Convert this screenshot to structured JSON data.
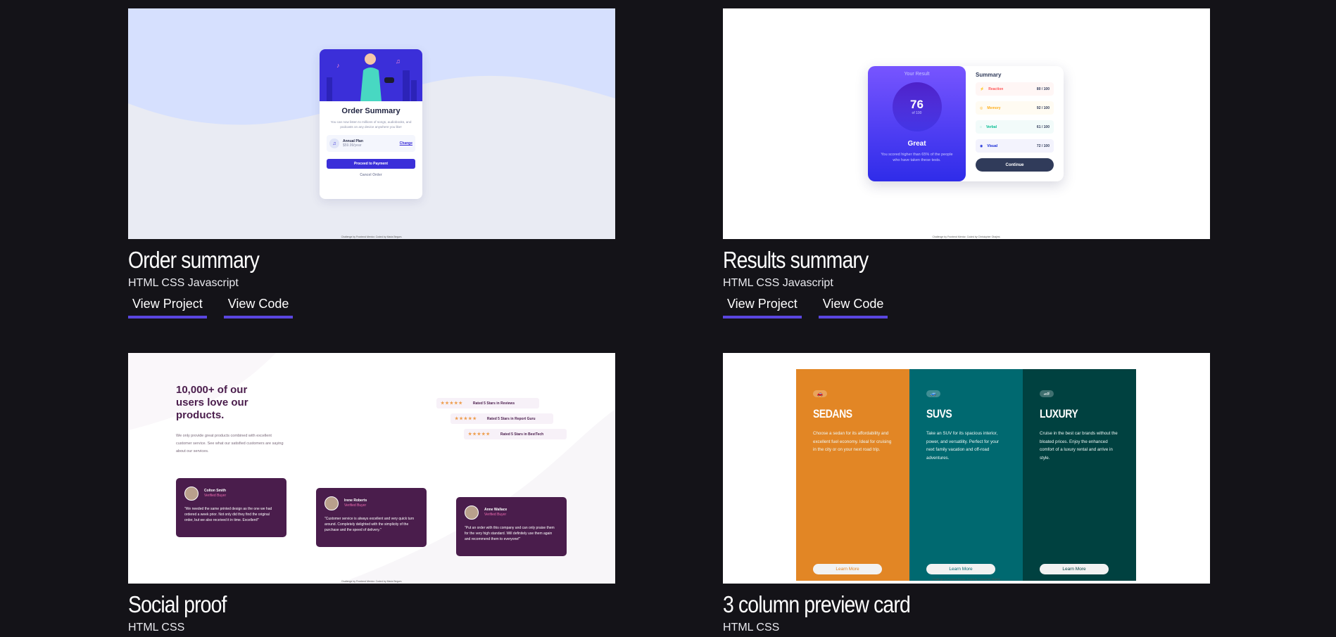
{
  "colors": {
    "background": "#141318",
    "accent_underline": "#5a46e0"
  },
  "projects": [
    {
      "title": "Order summary",
      "tech": "HTML CSS Javascript",
      "view_project": "View Project",
      "view_code": "View Code",
      "preview": {
        "card_title": "Order Summary",
        "card_text": "You can now listen to millions of songs, audiobooks, and podcasts on any device anywhere you like!",
        "plan_name": "Annual Plan",
        "plan_price": "$59.99/year",
        "change_link": "Change",
        "proceed_button": "Proceed to Payment",
        "cancel_button": "Cancel Order",
        "footer": "Challenge by Frontend Mentor. Coded by Maria Begum."
      }
    },
    {
      "title": "Results summary",
      "tech": "HTML CSS Javascript",
      "view_project": "View Project",
      "view_code": "View Code",
      "preview": {
        "your_result": "Your Result",
        "score": "76",
        "of_total": "of 100",
        "grade": "Great",
        "grade_text": "You scored higher than 65% of the people who have taken these tests.",
        "summary": "Summary",
        "rows": [
          {
            "label": "Reaction",
            "score": "80 / 100",
            "color": "#ff5757",
            "bg": "#fff6f5"
          },
          {
            "label": "Memory",
            "score": "92 / 100",
            "color": "#ffb01f",
            "bg": "#fffbf2"
          },
          {
            "label": "Verbal",
            "score": "61 / 100",
            "color": "#00bb8f",
            "bg": "#f2fbfa"
          },
          {
            "label": "Visual",
            "score": "72 / 100",
            "color": "#1125d6",
            "bg": "#f3f3fd"
          }
        ],
        "continue_button": "Continue",
        "footer": "Challenge by Frontend Mentor. Coded by Christopher Obajimi."
      }
    },
    {
      "title": "Social proof",
      "tech": "HTML CSS",
      "preview": {
        "heading": "10,000+ of our users love our products.",
        "paragraph": "We only provide great products combined with excellent customer service. See what our satisfied customers are saying about our services.",
        "stars": "★★★★★",
        "ratings": [
          "Rated 5 Stars in Reviews",
          "Rated 5 Stars in Report Guru",
          "Rated 5 Stars in BestTech"
        ],
        "testimonials": [
          {
            "name": "Colton Smith",
            "role": "Verified Buyer",
            "quote": "\"We needed the same printed design as the one we had ordered a week prior. Not only did they find the original order, but we also received it in time. Excellent!\""
          },
          {
            "name": "Irene Roberts",
            "role": "Verified Buyer",
            "quote": "\"Customer service is always excellent and very quick turn around. Completely delighted with the simplicity of the purchase and the speed of delivery.\""
          },
          {
            "name": "Anne Wallace",
            "role": "Verified Buyer",
            "quote": "\"Put an order with this company and can only praise them for the very high standard. Will definitely use them again and recommend them to everyone!\""
          }
        ],
        "footer": "Challenge by Frontend Mentor. Coded by Maria Begum."
      }
    },
    {
      "title": "3 column preview card",
      "tech": "HTML CSS",
      "preview": {
        "columns": [
          {
            "heading": "SEDANS",
            "text": "Choose a sedan for its affordability and excellent fuel economy. Ideal for cruising in the city or on your next road trip.",
            "button": "Learn More",
            "color": "#e28625",
            "btn_text_color": "#e28625"
          },
          {
            "heading": "SUVS",
            "text": "Take an SUV for its spacious interior, power, and versatility. Perfect for your next family vacation and off-road adventures.",
            "button": "Learn More",
            "color": "#006970",
            "btn_text_color": "#006970"
          },
          {
            "heading": "LUXURY",
            "text": "Cruise in the best car brands without the bloated prices. Enjoy the enhanced comfort of a luxury rental and arrive in style.",
            "button": "Learn More",
            "color": "#004140",
            "btn_text_color": "#004140"
          }
        ],
        "footer": "Challenge by Frontend Mentor. Coded by Christopher Obajimi."
      }
    }
  ]
}
